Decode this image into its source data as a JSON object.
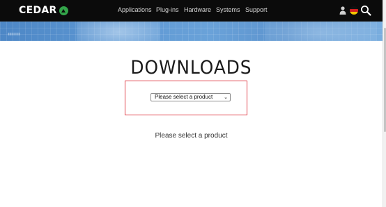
{
  "header": {
    "logo_text": "CEDAR",
    "nav": [
      "Applications",
      "Plug-ins",
      "Hardware",
      "Systems",
      "Support"
    ],
    "icons": [
      "user-icon",
      "language-flag-icon",
      "search-icon"
    ]
  },
  "main": {
    "title": "DOWNLOADS",
    "product_select": {
      "selected": "Please select a product"
    },
    "message": "Please select a product"
  },
  "colors": {
    "topbar_bg": "#0b0b0b",
    "logo_accent": "#33a54a",
    "banner": "#5d97d2",
    "highlight_border": "#e0434c"
  }
}
